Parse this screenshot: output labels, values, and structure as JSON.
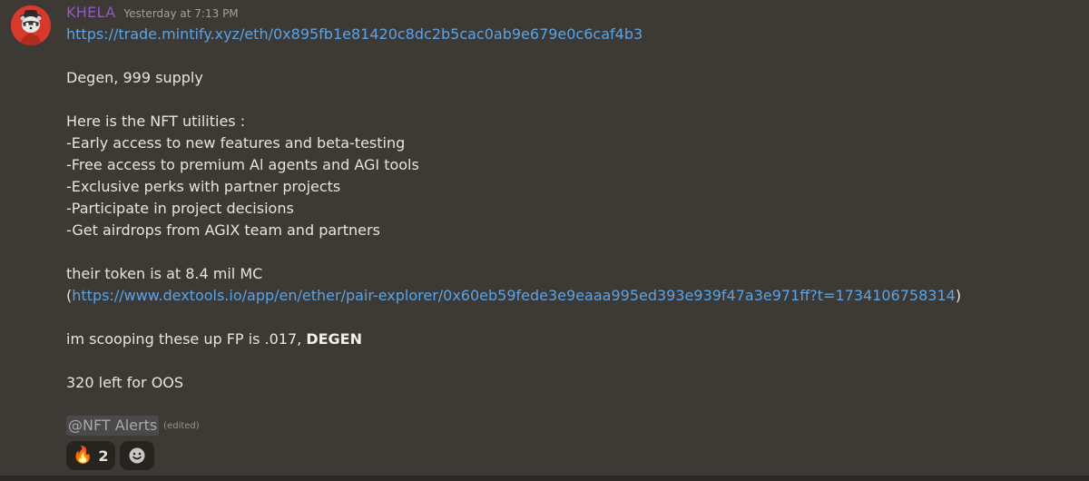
{
  "author": {
    "name": "KHELA",
    "timestamp": "Yesterday at 7:13 PM",
    "avatar_icon": "raccoon-avatar-icon",
    "name_color": "#8f5bc1"
  },
  "message": {
    "link1": "https://trade.mintify.xyz/eth/0x895fb1e81420c8dc2b5cac0ab9e679e0c6caf4b3",
    "line_supply": "Degen, 999 supply",
    "utilities_heading": "Here is the NFT utilities :",
    "utilities": [
      "-Early access to new features and beta-testing",
      "-Free access to premium Al agents and AGI tools",
      "-Exclusive perks with partner projects",
      "-Participate in project decisions",
      "-Get airdrops from AGIX team and partners"
    ],
    "token_line": "their token is at 8.4 mil MC",
    "paren_open": "(",
    "link2": "https://www.dextools.io/app/en/ether/pair-explorer/0x60eb59fede3e9eaaa995ed393e939f47a3e971ff?t=1734106758314",
    "paren_close": ")",
    "scoop_prefix": "im scooping these up FP is .017, ",
    "scoop_bold": "DEGEN",
    "oos_line": "320 left for OOS",
    "mention": "@NFT Alerts",
    "edited": "(edited)"
  },
  "reactions": [
    {
      "emoji": "🔥",
      "count": "2",
      "icon": "fire-icon"
    }
  ],
  "add_reaction_icon": "smiley-icon",
  "colors": {
    "background": "#3d3a35",
    "link": "#5aa3e6",
    "reaction_bg": "#26241f"
  }
}
